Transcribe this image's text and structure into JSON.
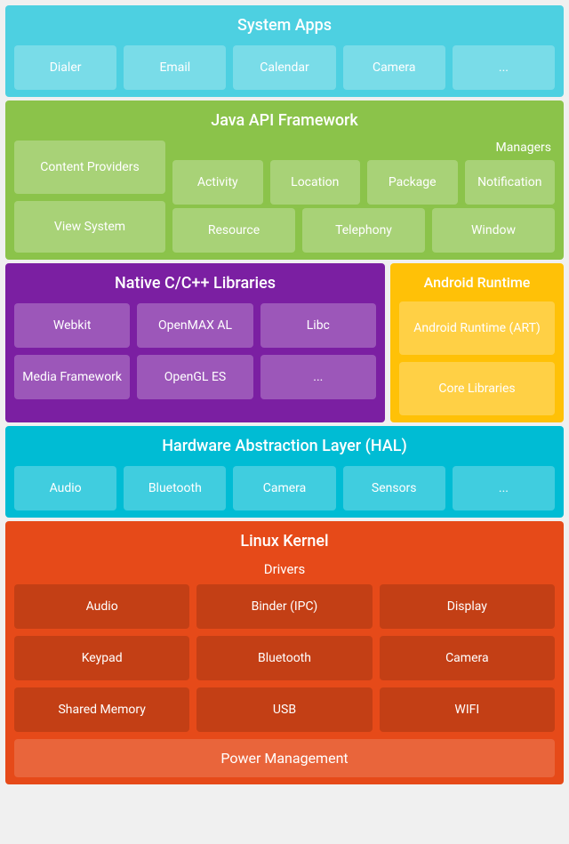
{
  "system_apps": {
    "title": "System Apps",
    "cells": [
      "Dialer",
      "Email",
      "Calendar",
      "Camera",
      "..."
    ]
  },
  "java_api": {
    "title": "Java API Framework",
    "managers_label": "Managers",
    "content_providers": "Content Providers",
    "view_system": "View System",
    "managers_row1": [
      "Activity",
      "Location",
      "Package",
      "Notification"
    ],
    "managers_row2": [
      "Resource",
      "Telephony",
      "Window"
    ]
  },
  "native": {
    "title": "Native C/C++ Libraries",
    "cells_row1": [
      "Webkit",
      "OpenMAX AL",
      "Libc"
    ],
    "cells_row2": [
      "Media Framework",
      "OpenGL ES",
      "..."
    ]
  },
  "android_runtime": {
    "title": "Android Runtime",
    "cells": [
      "Android Runtime (ART)",
      "Core Libraries"
    ]
  },
  "hal": {
    "title": "Hardware Abstraction Layer (HAL)",
    "cells": [
      "Audio",
      "Bluetooth",
      "Camera",
      "Sensors",
      "..."
    ]
  },
  "linux": {
    "title": "Linux Kernel",
    "drivers_label": "Drivers",
    "row1": [
      "Audio",
      "Binder (IPC)",
      "Display"
    ],
    "row2": [
      "Keypad",
      "Bluetooth",
      "Camera"
    ],
    "row3": [
      "Shared Memory",
      "USB",
      "WIFI"
    ],
    "power_management": "Power Management"
  }
}
